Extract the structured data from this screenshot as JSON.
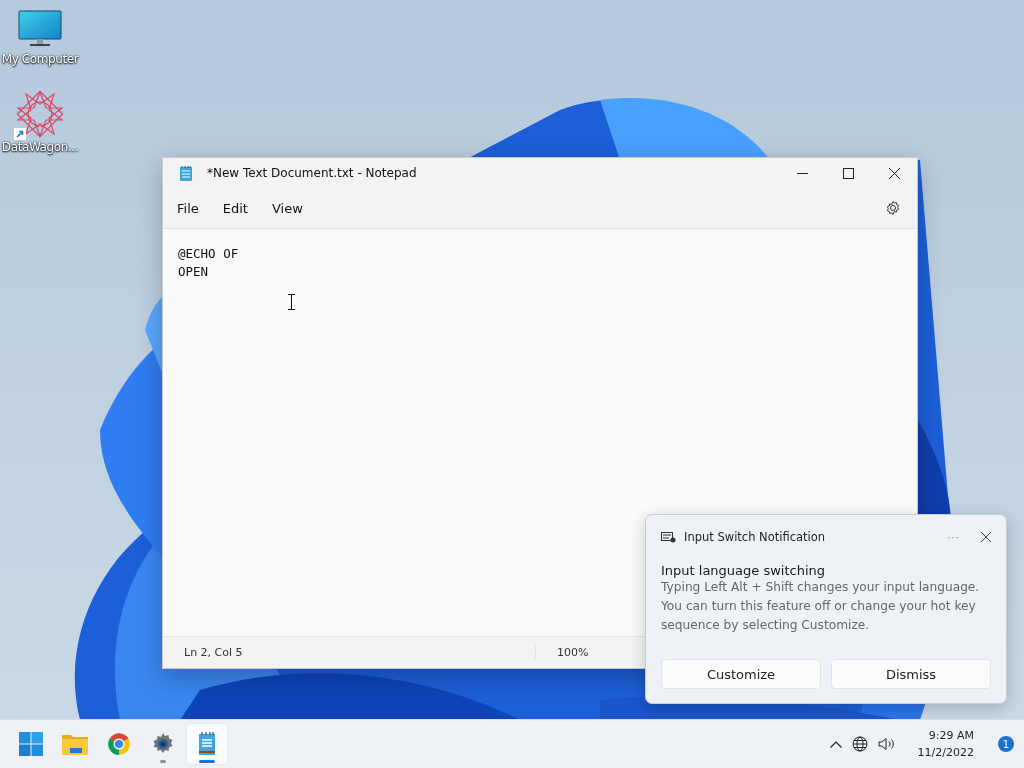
{
  "desktop_icons": [
    {
      "label": "My Computer",
      "kind": "computer",
      "shortcut": false
    },
    {
      "label": "DataWagon...",
      "kind": "star",
      "shortcut": true
    }
  ],
  "notepad": {
    "title": "*New Text Document.txt - Notepad",
    "menu": [
      "File",
      "Edit",
      "View"
    ],
    "lines": [
      "@ECHO OF",
      "OPEN"
    ],
    "status": {
      "position": "Ln 2, Col 5",
      "zoom": "100%"
    }
  },
  "notification": {
    "app": "Input Switch Notification",
    "more": "···",
    "heading": "Input language switching",
    "body": "Typing Left Alt + Shift changes your input language. You can turn this feature off or change your hot key sequence by selecting Customize.",
    "buttons": [
      "Customize",
      "Dismiss"
    ]
  },
  "taskbar": {
    "apps": [
      {
        "kind": "start",
        "running": false,
        "selected": false
      },
      {
        "kind": "folder",
        "running": false,
        "selected": false
      },
      {
        "kind": "browser",
        "running": false,
        "selected": false
      },
      {
        "kind": "settings",
        "running": true,
        "selected": false
      },
      {
        "kind": "notepad",
        "running": true,
        "selected": true
      }
    ],
    "time": "9:29 AM",
    "date": "11/2/2022",
    "badge": "1"
  }
}
